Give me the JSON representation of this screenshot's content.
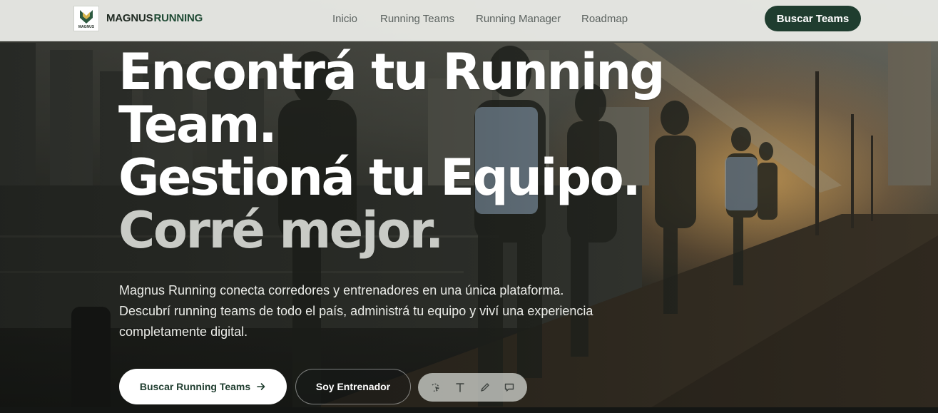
{
  "brand": {
    "logo_text": "MAGNUS",
    "name_part1": "MAGNUS",
    "name_part2": "RUNNING",
    "accent_color": "#1f4a34"
  },
  "nav": {
    "links": [
      "Inicio",
      "Running Teams",
      "Running Manager",
      "Roadmap"
    ],
    "cta_label": "Buscar Teams"
  },
  "hero": {
    "headline_lines": [
      "Encontrá tu Running",
      "Team.",
      "Gestioná tu Equipo.",
      "Corré mejor."
    ],
    "lead": "Magnus Running conecta corredores y entrenadores en una única plataforma. Descubrí running teams de todo el país, administrá tu equipo y viví una experiencia completamente digital.",
    "primary_button": "Buscar Running Teams",
    "primary_icon": "arrow-right-icon",
    "secondary_button": "Soy Entrenador"
  },
  "toolbar": {
    "tools": [
      "select-icon",
      "text-icon",
      "pencil-icon",
      "comment-icon"
    ]
  },
  "colors": {
    "primary": "#1f3d2f",
    "nav_bg": "#e8e9e5"
  }
}
